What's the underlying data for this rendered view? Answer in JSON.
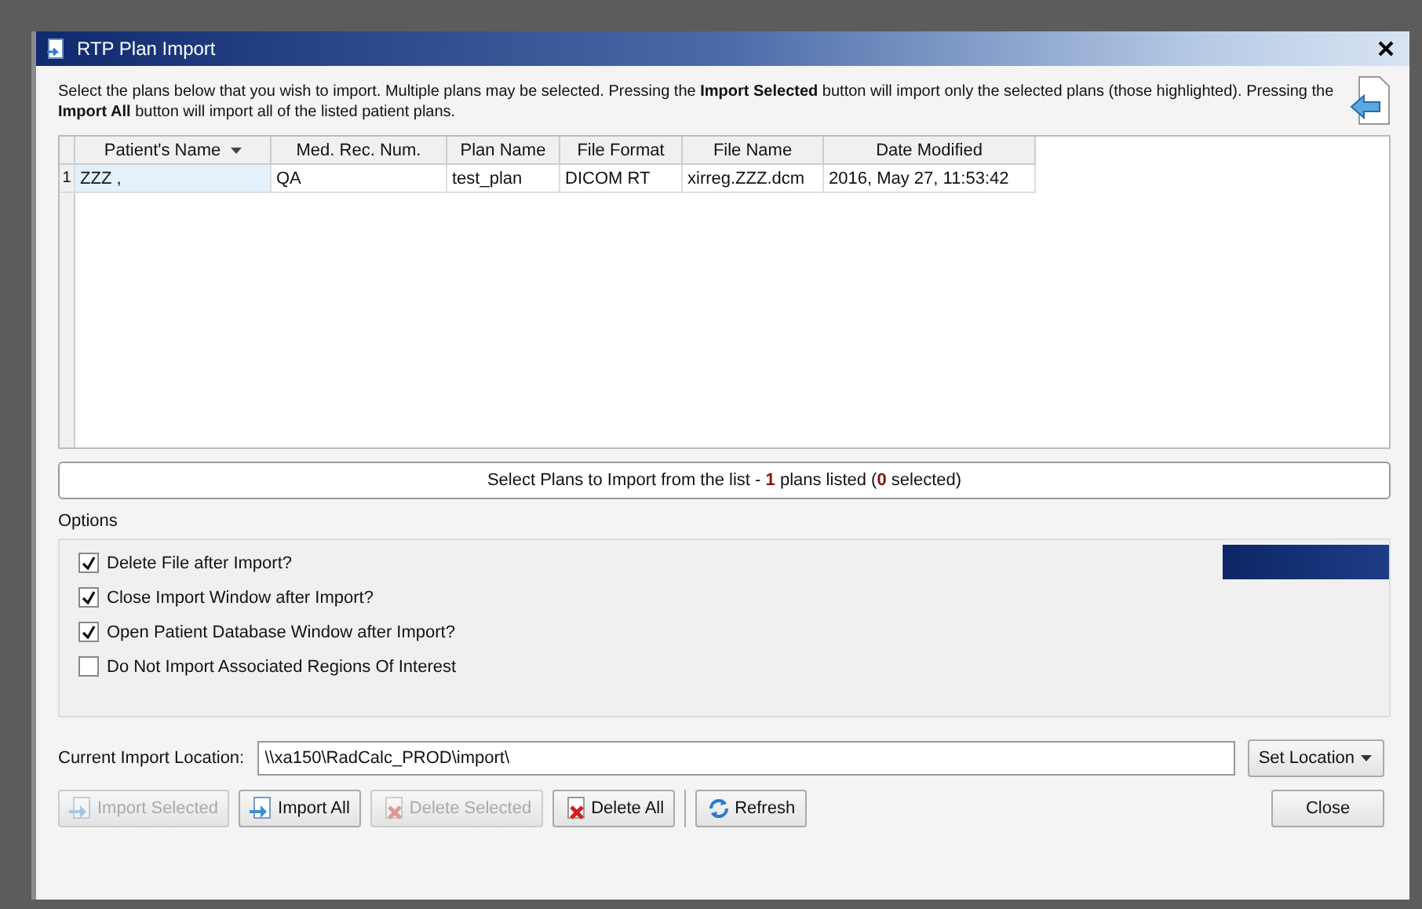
{
  "window": {
    "title": "RTP Plan Import"
  },
  "instructions": "Select the plans below that you wish to import. Multiple plans may be selected. Pressing the **Import Selected** button will import only the selected plans (those highlighted). Pressing the **Import All** button will import all of the listed patient plans.",
  "table": {
    "columns": [
      {
        "label": "Patient's Name",
        "sorted": true
      },
      {
        "label": "Med. Rec. Num.",
        "sorted": false
      },
      {
        "label": "Plan Name",
        "sorted": false
      },
      {
        "label": "File Format",
        "sorted": false
      },
      {
        "label": "File Name",
        "sorted": false
      },
      {
        "label": "Date Modified",
        "sorted": false
      }
    ],
    "rows": [
      {
        "number": "1",
        "current": true,
        "selected": false,
        "cells": [
          "ZZZ ,",
          "QA",
          "test_plan",
          "DICOM RT",
          "xirreg.ZZZ.dcm",
          "2016, May 27, 11:53:42"
        ]
      }
    ]
  },
  "status": "Select Plans to Import from the list - **1** plans listed (**0** selected)",
  "options": {
    "label": "Options",
    "items": [
      {
        "label": "Delete File after Import?",
        "checked": true
      },
      {
        "label": "Close Import Window after Import?",
        "checked": true
      },
      {
        "label": "Open Patient Database Window after Import?",
        "checked": true
      },
      {
        "label": "Do Not Import Associated Regions Of Interest",
        "checked": false
      }
    ]
  },
  "location": {
    "label": "Current Import Location:",
    "value": "\\\\xa150\\RadCalc_PROD\\import\\",
    "button": "Set Location"
  },
  "buttons": [
    {
      "label": "Import Selected",
      "kind": "import",
      "disabled": true
    },
    {
      "label": "Import All",
      "kind": "import",
      "disabled": false
    },
    {
      "label": "Delete Selected",
      "kind": "delete",
      "disabled": true
    },
    {
      "label": "Delete All",
      "kind": "delete",
      "disabled": false
    },
    {
      "label": "Refresh",
      "kind": "refresh",
      "disabled": false
    }
  ],
  "close_button": "Close"
}
